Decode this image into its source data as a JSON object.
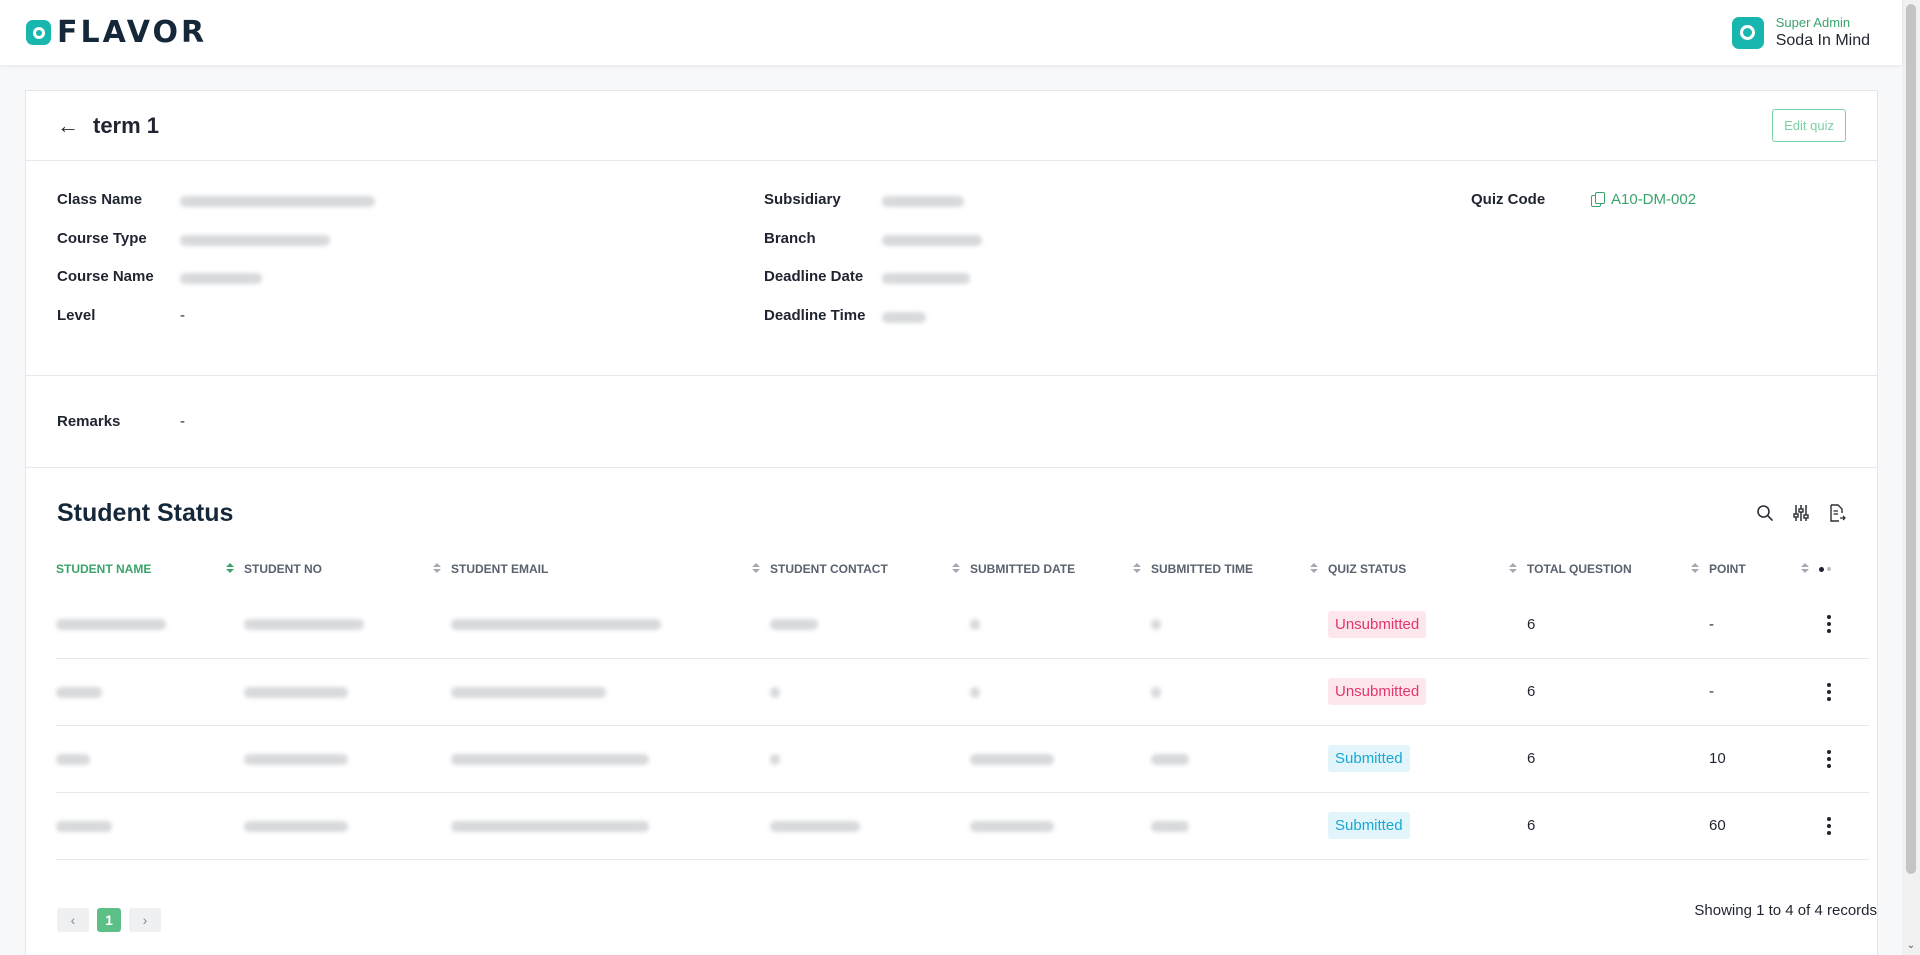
{
  "brand": {
    "name": "FLAVOR"
  },
  "user": {
    "role": "Super Admin",
    "name": "Soda In Mind"
  },
  "page": {
    "title": "term 1",
    "edit_label": "Edit quiz"
  },
  "info": {
    "class_name_label": "Class Name",
    "course_type_label": "Course Type",
    "course_name_label": "Course Name",
    "level_label": "Level",
    "level_value": "-",
    "subsidiary_label": "Subsidiary",
    "branch_label": "Branch",
    "deadline_date_label": "Deadline Date",
    "deadline_time_label": "Deadline Time",
    "quiz_code_label": "Quiz Code",
    "quiz_code_value": "A10-DM-002",
    "remarks_label": "Remarks",
    "remarks_value": "-"
  },
  "students": {
    "title": "Student Status",
    "columns": [
      "STUDENT NAME",
      "STUDENT NO",
      "STUDENT EMAIL",
      "STUDENT CONTACT",
      "SUBMITTED DATE",
      "SUBMITTED TIME",
      "QUIZ STATUS",
      "TOTAL QUESTION",
      "POINT"
    ],
    "rows": [
      {
        "status": "Unsubmitted",
        "total": "6",
        "point": "-"
      },
      {
        "status": "Unsubmitted",
        "total": "6",
        "point": "-"
      },
      {
        "status": "Submitted",
        "total": "6",
        "point": "10"
      },
      {
        "status": "Submitted",
        "total": "6",
        "point": "60"
      }
    ],
    "pagination": {
      "prev": "‹",
      "current": "1",
      "next": "›"
    },
    "records_text": "Showing 1 to 4 of 4 records"
  },
  "icons": {
    "search": "search-icon",
    "filter": "sliders-icon",
    "export": "export-file-icon",
    "back": "arrow-left-icon",
    "copy": "copy-icon",
    "more": "kebab-menu-icon"
  },
  "colors": {
    "accent": "#3aa36b",
    "brand": "#17b7b0",
    "unsubmitted": "#e2366b",
    "submitted": "#19a7d4"
  }
}
